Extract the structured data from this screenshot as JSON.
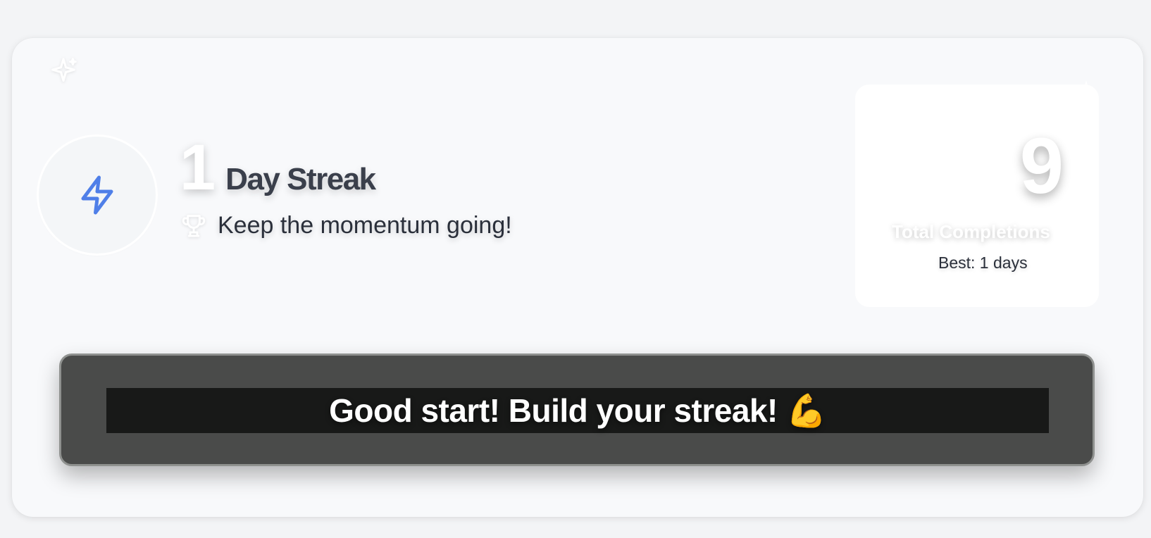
{
  "streak": {
    "count": "1",
    "label": "Day Streak",
    "motivation": "Keep the momentum going!"
  },
  "stats": {
    "total_completions": "9",
    "total_label": "Total Completions",
    "best_label": "Best: 1 days"
  },
  "banner": {
    "message": "Good start! Build your streak! 💪"
  },
  "icons": {
    "sparkle": "sparkle-icon",
    "bolt": "lightning-bolt-icon",
    "trophy": "trophy-icon"
  },
  "colors": {
    "bolt": "#4f7fe8",
    "card_background": "#f8f9fb",
    "banner_background": "#4a4b4a",
    "banner_inner": "#181918",
    "heading_text": "#3a3f4b"
  }
}
